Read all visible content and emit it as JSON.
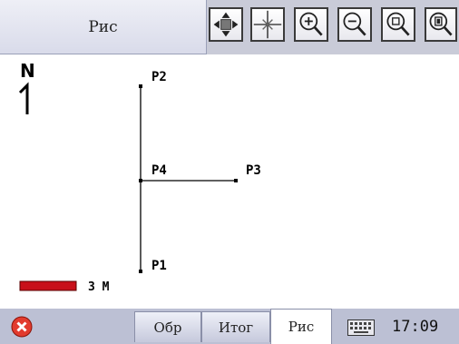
{
  "header": {
    "title": "Рис",
    "tools": [
      {
        "icon": "pan-icon"
      },
      {
        "icon": "center-icon"
      },
      {
        "icon": "zoom-in-icon"
      },
      {
        "icon": "zoom-out-icon"
      },
      {
        "icon": "zoom-window-icon"
      },
      {
        "icon": "zoom-all-icon"
      }
    ]
  },
  "map": {
    "north_label": "N",
    "scale_label": "3 M",
    "scale_color": "#c8101a",
    "points": [
      {
        "label": "P2"
      },
      {
        "label": "P4"
      },
      {
        "label": "P3"
      },
      {
        "label": "P1"
      }
    ]
  },
  "footer": {
    "tabs": [
      {
        "label": "Обр",
        "active": false
      },
      {
        "label": "Итог",
        "active": false
      },
      {
        "label": "Рис",
        "active": true
      }
    ],
    "time": "17:09",
    "close_icon": "close-icon",
    "keyboard_icon": "keyboard-icon"
  }
}
